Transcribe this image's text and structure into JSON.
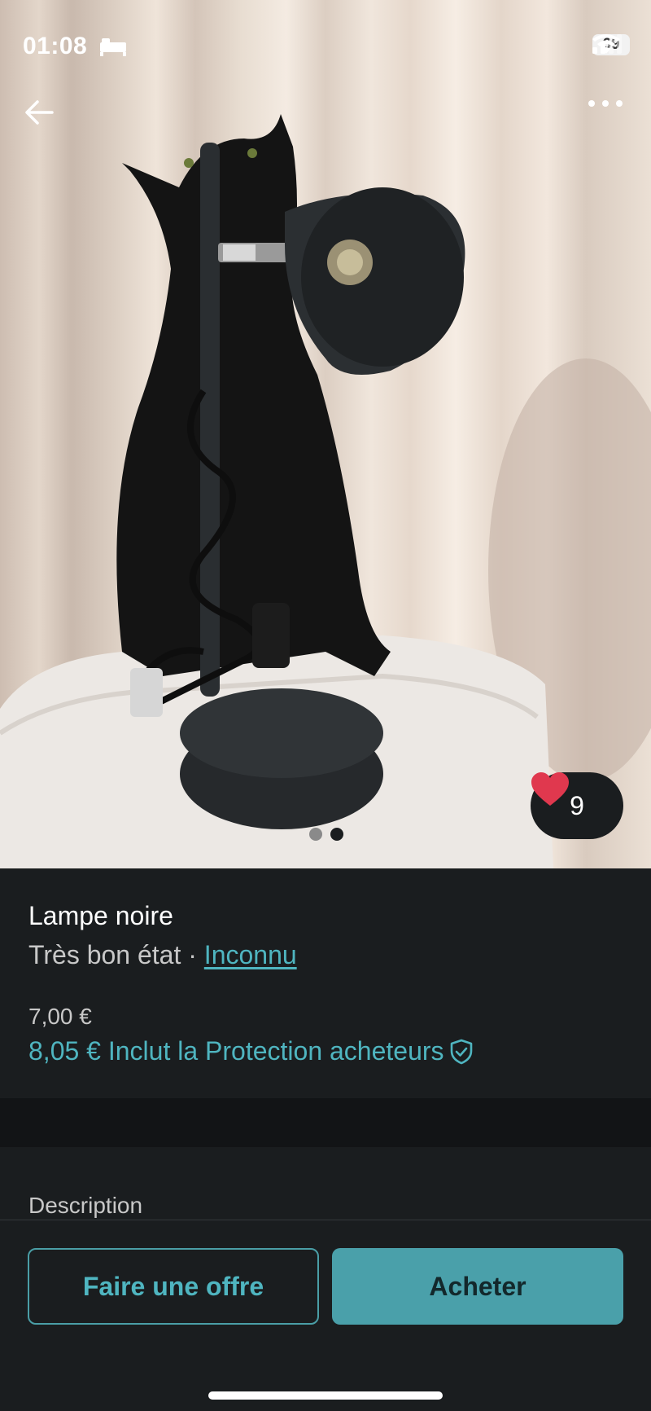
{
  "status_bar": {
    "time": "01:08",
    "battery": "69",
    "icons": [
      "bed-icon",
      "signal-icon",
      "wifi-icon",
      "battery-icon"
    ]
  },
  "nav": {
    "back_icon": "arrow-left-icon",
    "more_icon": "more-horizontal-icon"
  },
  "photo": {
    "favorites_count": "9",
    "current_image": 2,
    "total_images": 2
  },
  "item": {
    "title": "Lampe noire",
    "condition": "Très bon état",
    "separator": "·",
    "brand": "Inconnu",
    "price": "7,00 €",
    "price_with_protection": "8,05 € Inclut la Protection acheteurs"
  },
  "description": {
    "label": "Description"
  },
  "actions": {
    "offer_label": "Faire une offre",
    "buy_label": "Acheter"
  },
  "colors": {
    "background": "#1a1d1f",
    "accent": "#4fb5c0",
    "buy_button": "#4aa0aa",
    "heart": "#e0384e"
  }
}
